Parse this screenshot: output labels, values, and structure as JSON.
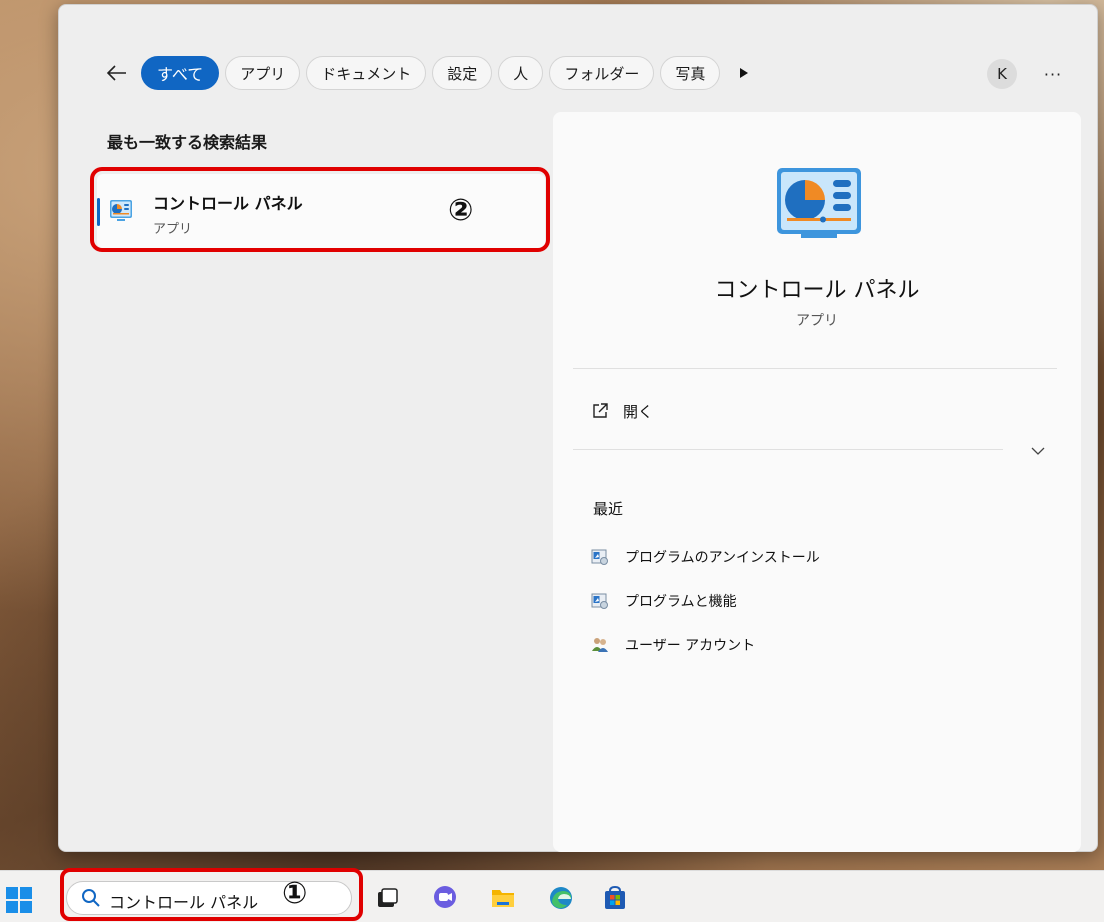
{
  "filters": {
    "back_label": "←",
    "chips": [
      "すべて",
      "アプリ",
      "ドキュメント",
      "設定",
      "人",
      "フォルダー",
      "写真"
    ],
    "more_label": "▶",
    "avatar_initial": "K",
    "menu_label": "···"
  },
  "best_match": {
    "title": "最も一致する検索結果",
    "name": "コントロール パネル",
    "type": "アプリ"
  },
  "detail": {
    "name": "コントロール パネル",
    "type": "アプリ",
    "open_label": "開く",
    "recent_title": "最近",
    "recent_items": [
      "プログラムのアンインストール",
      "プログラムと機能",
      "ユーザー アカウント"
    ]
  },
  "taskbar": {
    "search_text": "コントロール パネル",
    "apps": [
      "task-view-icon",
      "teams-chat-icon",
      "file-explorer-icon",
      "edge-icon",
      "store-icon"
    ]
  },
  "annotations": {
    "one": "①",
    "two": "②"
  },
  "colors": {
    "accent": "#1066c3",
    "annotation_red": "#e00000"
  }
}
